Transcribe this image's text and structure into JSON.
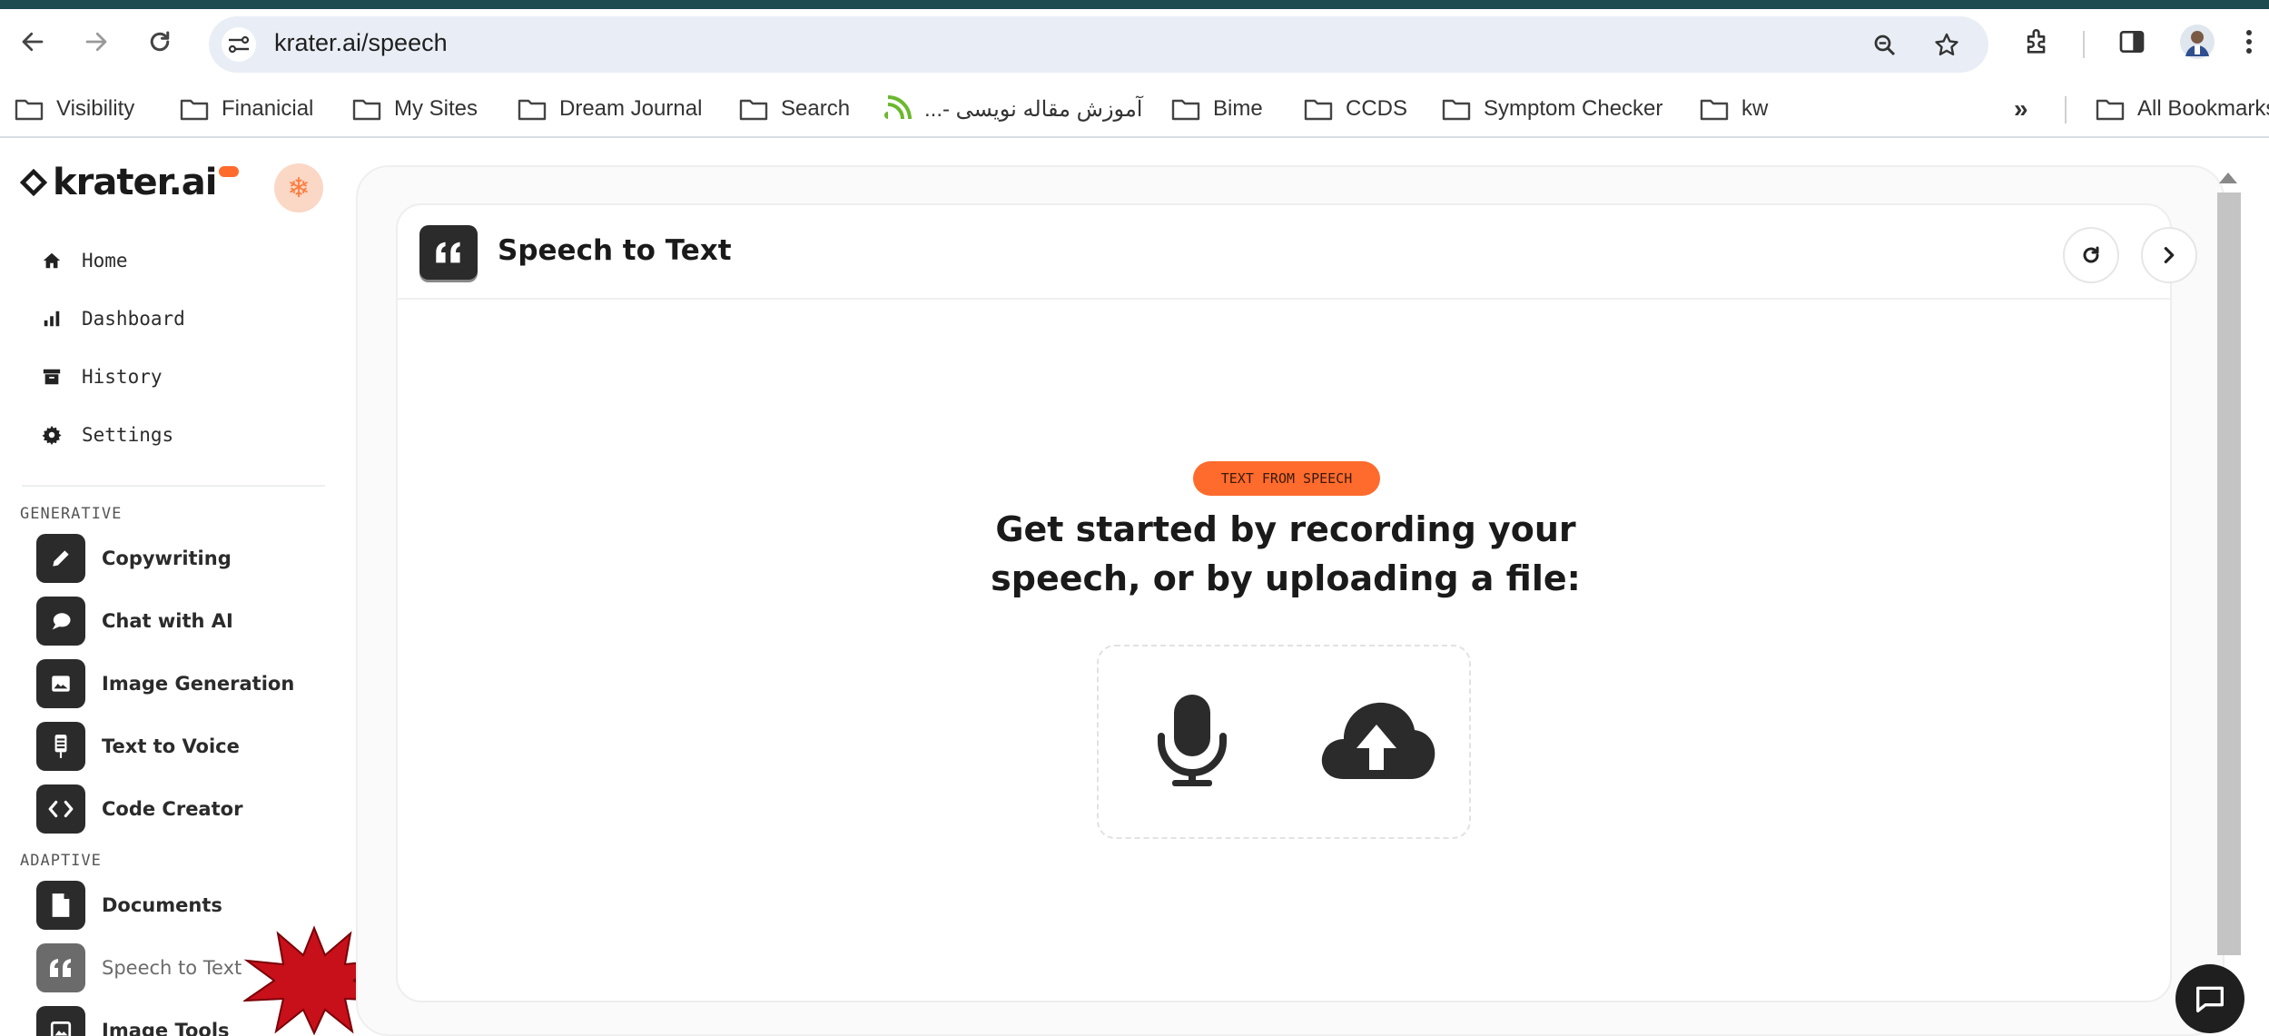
{
  "browser": {
    "url": "krater.ai/speech",
    "bookmarks": [
      {
        "label": "Visibility",
        "type": "folder"
      },
      {
        "label": "Finanicial",
        "type": "folder"
      },
      {
        "label": "My Sites",
        "type": "folder"
      },
      {
        "label": "Dream Journal",
        "type": "folder"
      },
      {
        "label": "Search",
        "type": "folder"
      },
      {
        "label": "آموزش مقاله نویسی -...",
        "type": "link"
      },
      {
        "label": "Bime",
        "type": "folder"
      },
      {
        "label": "CCDS",
        "type": "folder"
      },
      {
        "label": "Symptom Checker",
        "type": "folder"
      },
      {
        "label": "kw",
        "type": "folder"
      }
    ],
    "overflow_label": "»",
    "all_bookmarks_label": "All Bookmarks"
  },
  "sidebar": {
    "logo": "krater.ai",
    "nav": [
      {
        "label": "Home",
        "icon": "home-icon"
      },
      {
        "label": "Dashboard",
        "icon": "bar-chart-icon"
      },
      {
        "label": "History",
        "icon": "archive-icon"
      },
      {
        "label": "Settings",
        "icon": "gear-icon"
      }
    ],
    "generative_label": "GENERATIVE",
    "generative": [
      {
        "label": "Copywriting",
        "icon": "pencil-icon"
      },
      {
        "label": "Chat with AI",
        "icon": "chat-icon"
      },
      {
        "label": "Image Generation",
        "icon": "image-icon"
      },
      {
        "label": "Text to Voice",
        "icon": "voice-icon"
      },
      {
        "label": "Code Creator",
        "icon": "code-icon"
      }
    ],
    "adaptive_label": "ADAPTIVE",
    "adaptive": [
      {
        "label": "Documents",
        "icon": "document-icon"
      },
      {
        "label": "Speech to Text",
        "icon": "quote-icon",
        "active": true
      },
      {
        "label": "Image Tools",
        "icon": "image-tools-icon"
      }
    ]
  },
  "main": {
    "title": "Speech to Text",
    "badge": "TEXT FROM SPEECH",
    "headline_line1": "Get started by recording your",
    "headline_line2": "speech, or by uploading a file:"
  },
  "colors": {
    "accent": "#ff6b2d",
    "dark": "#2b2b2b",
    "browser_top": "#1e4a52"
  }
}
